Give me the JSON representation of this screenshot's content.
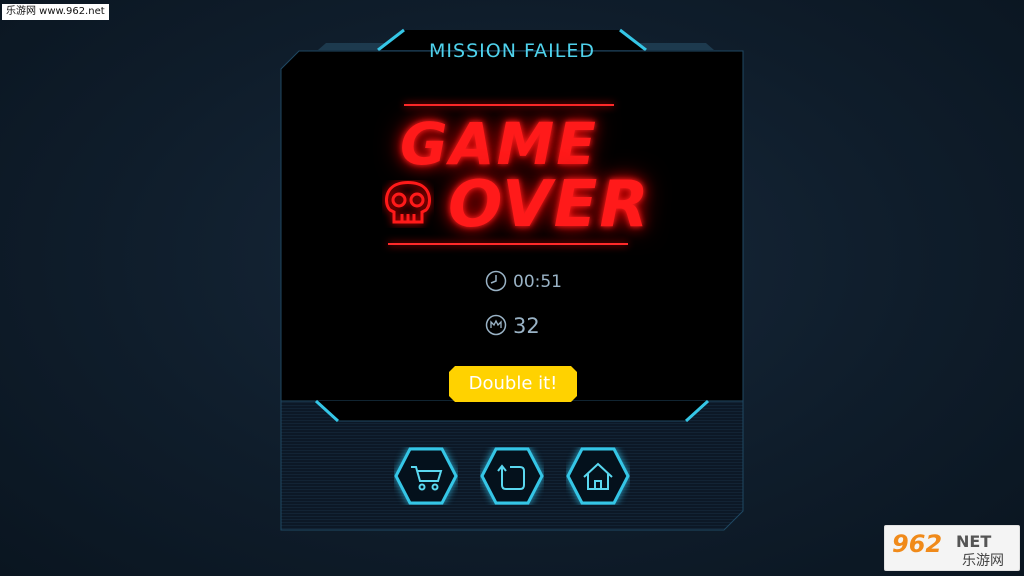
{
  "watermark_top": "乐游网 www.962.net",
  "dialog": {
    "title": "MISSION FAILED",
    "headline_line1": "GAME",
    "headline_line2": "OVER",
    "time": "00:51",
    "score": "32",
    "double_button": "Double it!"
  },
  "nav_buttons": [
    {
      "icon": "cart-icon"
    },
    {
      "icon": "restart-icon"
    },
    {
      "icon": "home-icon"
    }
  ],
  "watermark_bottom": {
    "brand": "962",
    "suffix": "NET",
    "cn": "乐游网"
  },
  "colors": {
    "cyan": "#4fd2ec",
    "red": "#ff1a1a",
    "yellow": "#ffd200",
    "panel": "#000000",
    "stat_text": "#9ab3c6"
  }
}
